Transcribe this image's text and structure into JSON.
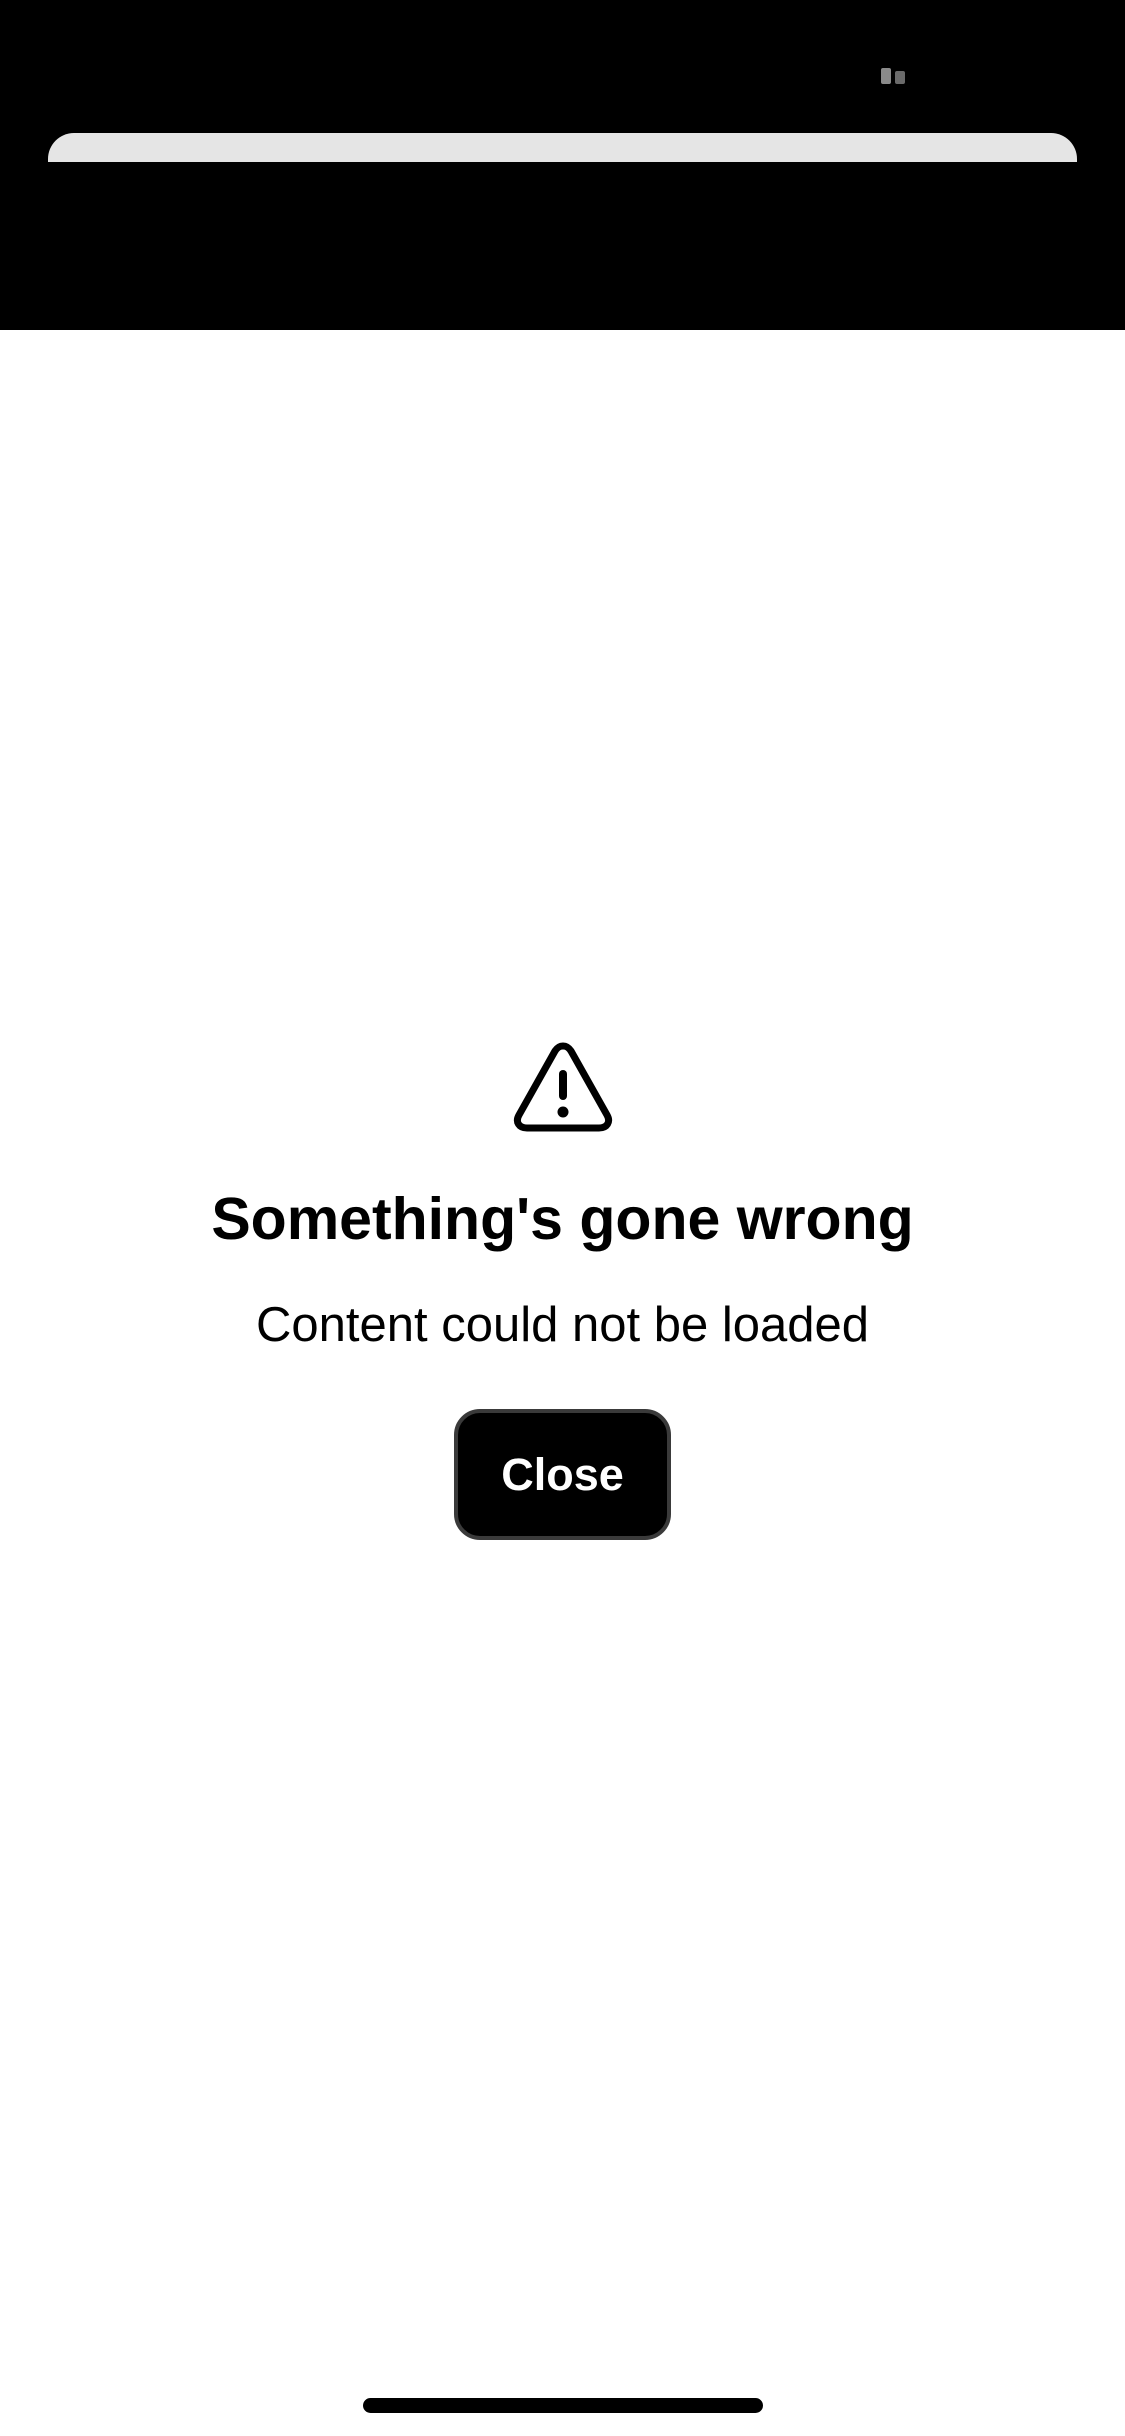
{
  "icons": {
    "status": "status-dots-icon",
    "warning": "warning-triangle-icon"
  },
  "colors": {
    "header_background": "#000000",
    "page_background": "#ffffff",
    "sheet_grabber": "#e5e5e5",
    "button_background": "#000000",
    "button_border": "#3a3a3a",
    "button_text": "#ffffff",
    "text": "#000000"
  },
  "error": {
    "title": "Something's gone wrong",
    "message": "Content could not be loaded",
    "close_label": "Close"
  }
}
